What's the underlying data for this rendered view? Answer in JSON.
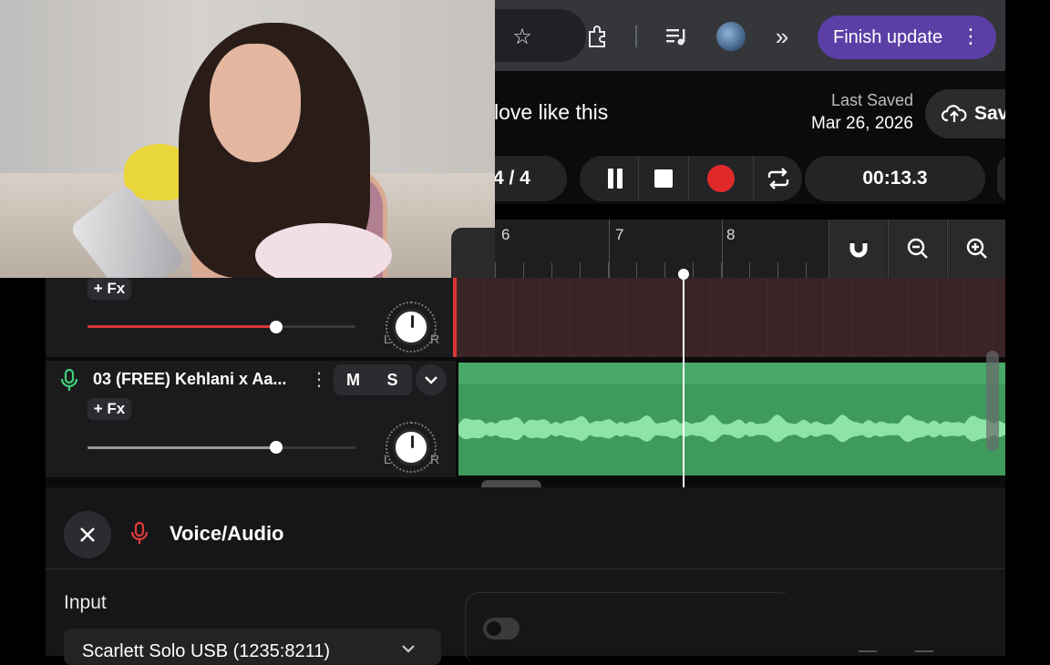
{
  "browser": {
    "finish_update_label": "Finish update",
    "icons": [
      "star-icon",
      "extensions-icon",
      "media-controls-icon",
      "profile-avatar",
      "more-chevrons-icon",
      "kebab-menu-icon"
    ]
  },
  "header": {
    "project_title": "love like this",
    "last_saved_label": "Last Saved",
    "last_saved_date": "Mar 26, 2026",
    "save_label": "Sav"
  },
  "transport": {
    "beat_counter": "4 / 4",
    "time": "00:13.3"
  },
  "ruler": {
    "bar_numbers": [
      "6",
      "7",
      "8"
    ]
  },
  "tracks": [
    {
      "fx_label": "+ Fx",
      "pan_left": "L",
      "pan_right": "R",
      "volume": 0.7,
      "color": "#d93636"
    },
    {
      "name": "03  (FREE) Kehlani x Aa...",
      "mute_label": "M",
      "solo_label": "S",
      "fx_label": "+ Fx",
      "pan_left": "L",
      "pan_right": "R",
      "volume": 0.7,
      "color": "#3fd07a"
    }
  ],
  "panel": {
    "title": "Voice/Audio",
    "input_label": "Input",
    "input_value": "Scarlett Solo USB (1235:8211)"
  },
  "colors": {
    "accent_purple": "#5b3fa6",
    "record_red": "#e02a2a",
    "track_green": "#3f9a5d"
  }
}
